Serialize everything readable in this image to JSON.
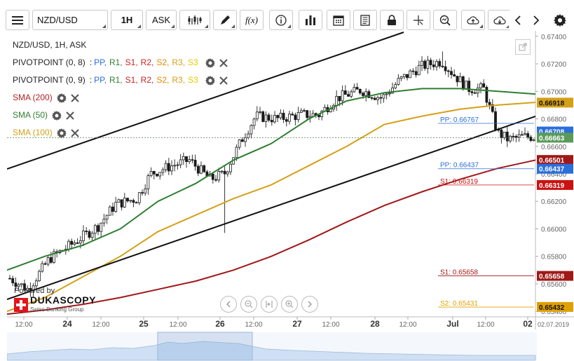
{
  "toolbar": {
    "symbol": "NZD/USD",
    "timeframe": "1H",
    "price_side": "ASK",
    "fx_label": "f(x)"
  },
  "chart_header": "NZD/USD, 1H, ASK",
  "indicators": [
    {
      "name": "PIVOTPOINT (0, 8)",
      "sep": ":",
      "levels": [
        "PP,",
        "R1,",
        "S1,",
        "R2,",
        "S2,",
        "R3,",
        "S3"
      ],
      "color": "#222"
    },
    {
      "name": "PIVOTPOINT (0, 9)",
      "sep": ":",
      "levels": [
        "PP,",
        "R1,",
        "S1,",
        "R2,",
        "S2,",
        "R3,",
        "S3"
      ],
      "color": "#222"
    },
    {
      "name": "SMA (200)",
      "color": "#b22222"
    },
    {
      "name": "SMA (50)",
      "color": "#2e7d32"
    },
    {
      "name": "SMA (100)",
      "color": "#d4a017"
    }
  ],
  "level_colors": [
    "#2a6fdb",
    "#2e7d32",
    "#cc2222",
    "#cc2222",
    "#e08a00",
    "#d4a017",
    "#e8c800"
  ],
  "price_axis": {
    "ticks": [
      "0.67400",
      "0.67200",
      "0.67000",
      "0.66800",
      "0.66600",
      "0.66400",
      "0.66200",
      "0.66000",
      "0.65800",
      "0.65600",
      "0.65400"
    ],
    "tick_values": [
      0.674,
      0.672,
      0.67,
      0.668,
      0.666,
      0.664,
      0.662,
      0.66,
      0.658,
      0.656,
      0.654
    ]
  },
  "price_tags": [
    {
      "label": "0.66918",
      "value": 0.66918,
      "bg": "#d4a017",
      "fg": "#111"
    },
    {
      "label": "0.66708",
      "value": 0.66708,
      "bg": "#2a6fdb",
      "fg": "#fff"
    },
    {
      "label": "0.66663",
      "value": 0.66663,
      "bg": "#5a9a5a",
      "fg": "#fff"
    },
    {
      "label": "0.66501",
      "value": 0.66501,
      "bg": "#a01818",
      "fg": "#fff"
    },
    {
      "label": "0.66437",
      "value": 0.66437,
      "bg": "#2a6fdb",
      "fg": "#fff"
    },
    {
      "label": "0.66319",
      "value": 0.66319,
      "bg": "#cc1111",
      "fg": "#fff"
    },
    {
      "label": "0.65658",
      "value": 0.65658,
      "bg": "#a01818",
      "fg": "#fff"
    },
    {
      "label": "0.65432",
      "value": 0.65432,
      "bg": "#e0a000",
      "fg": "#111"
    }
  ],
  "pivot_labels": [
    {
      "label": "PP: 0.66767",
      "value": 0.66767,
      "color": "#2a6fdb",
      "x0": 625,
      "x1": 762
    },
    {
      "label": "PP: 0.66437",
      "value": 0.66437,
      "color": "#2a6fdb",
      "x0": 625,
      "x1": 762
    },
    {
      "label": "S1: 0.66319",
      "value": 0.66319,
      "color": "#cc1111",
      "x0": 625,
      "x1": 762
    },
    {
      "label": "S1: 0.65658",
      "value": 0.65658,
      "color": "#a01818",
      "x0": 625,
      "x1": 762
    },
    {
      "label": "S2: 0.65431",
      "value": 0.65431,
      "color": "#e0a000",
      "x0": 625,
      "x1": 762
    }
  ],
  "time_axis": {
    "labels": [
      "12:00",
      "24",
      "12:00",
      "25",
      "12:00",
      "26",
      "12:00",
      "27",
      "12:00",
      "28",
      "12:00",
      "Jul",
      "12:00",
      "02",
      "02.07.2019"
    ],
    "bold": [
      false,
      true,
      false,
      true,
      false,
      true,
      false,
      true,
      false,
      true,
      false,
      true,
      false,
      true,
      false
    ]
  },
  "branding": {
    "powered_by": "Powered by",
    "name": "DUKASCOPY",
    "tagline": "Swiss Banking Group"
  },
  "chart_data": {
    "type": "candlestick",
    "symbol": "NZD/USD",
    "interval": "1H",
    "current_price": 0.66663,
    "series": [
      {
        "name": "SMA (200)",
        "color": "#a01818",
        "values": [
          0.6538,
          0.6541,
          0.6545,
          0.655,
          0.6556,
          0.6562,
          0.657,
          0.658,
          0.6592,
          0.6605,
          0.6617,
          0.6627,
          0.6636,
          0.6644,
          0.665
        ]
      },
      {
        "name": "SMA (50)",
        "color": "#2e7d32",
        "values": [
          0.657,
          0.658,
          0.6588,
          0.66,
          0.662,
          0.6633,
          0.665,
          0.6662,
          0.668,
          0.6693,
          0.6699,
          0.6702,
          0.6702,
          0.67,
          0.6698
        ]
      },
      {
        "name": "SMA (100)",
        "color": "#d4a017",
        "values": [
          0.654,
          0.655,
          0.6565,
          0.658,
          0.6598,
          0.661,
          0.6622,
          0.6632,
          0.6646,
          0.666,
          0.6676,
          0.6682,
          0.6687,
          0.669,
          0.6692
        ]
      }
    ],
    "ylim": [
      0.6536,
      0.6744
    ]
  }
}
